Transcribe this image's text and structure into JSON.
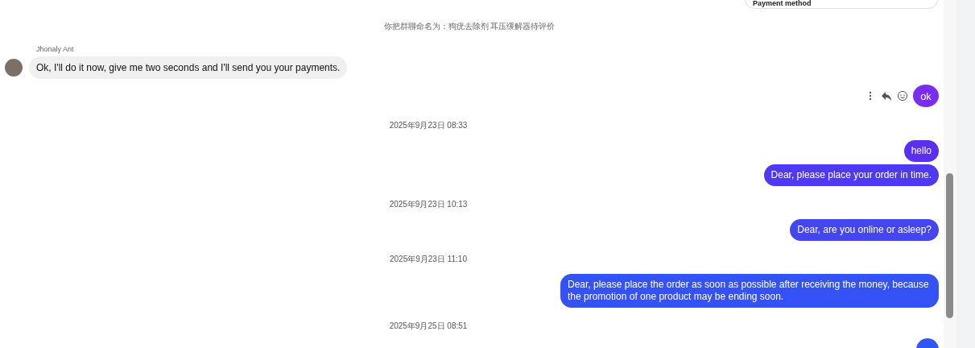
{
  "top_card": {
    "text": "Payment method"
  },
  "items": [
    {
      "kind": "notice",
      "text": "你把群聊命名为：狗疣去除剂 耳压缓解器待评价"
    },
    {
      "kind": "incoming",
      "sender": "Jhonaly Ant",
      "text": "Ok, I'll do it now, give me two seconds and I'll send you your payments."
    },
    {
      "kind": "outgoing",
      "text": "ok",
      "color": "#7a2cf0",
      "actions": true
    },
    {
      "kind": "time",
      "text": "2025年9月23日 08:33"
    },
    {
      "kind": "outgoing",
      "text": "hello",
      "color": "#5a30f0"
    },
    {
      "kind": "outgoing",
      "text": "Dear, please place your order in time.",
      "color": "#4e3af2"
    },
    {
      "kind": "time",
      "text": "2025年9月23日 10:13"
    },
    {
      "kind": "outgoing",
      "text": "Dear, are you online or asleep?",
      "color": "#4445f3"
    },
    {
      "kind": "time",
      "text": "2025年9月23日 11:10"
    },
    {
      "kind": "outgoing",
      "text": "Dear, please place the order as soon as possible after receiving the money, because the promotion of one product may be ending soon.",
      "color": "#3452f5"
    },
    {
      "kind": "time",
      "text": "2025年9月25日 08:51"
    },
    {
      "kind": "outgoing_cut",
      "color": "#3156f5"
    }
  ]
}
